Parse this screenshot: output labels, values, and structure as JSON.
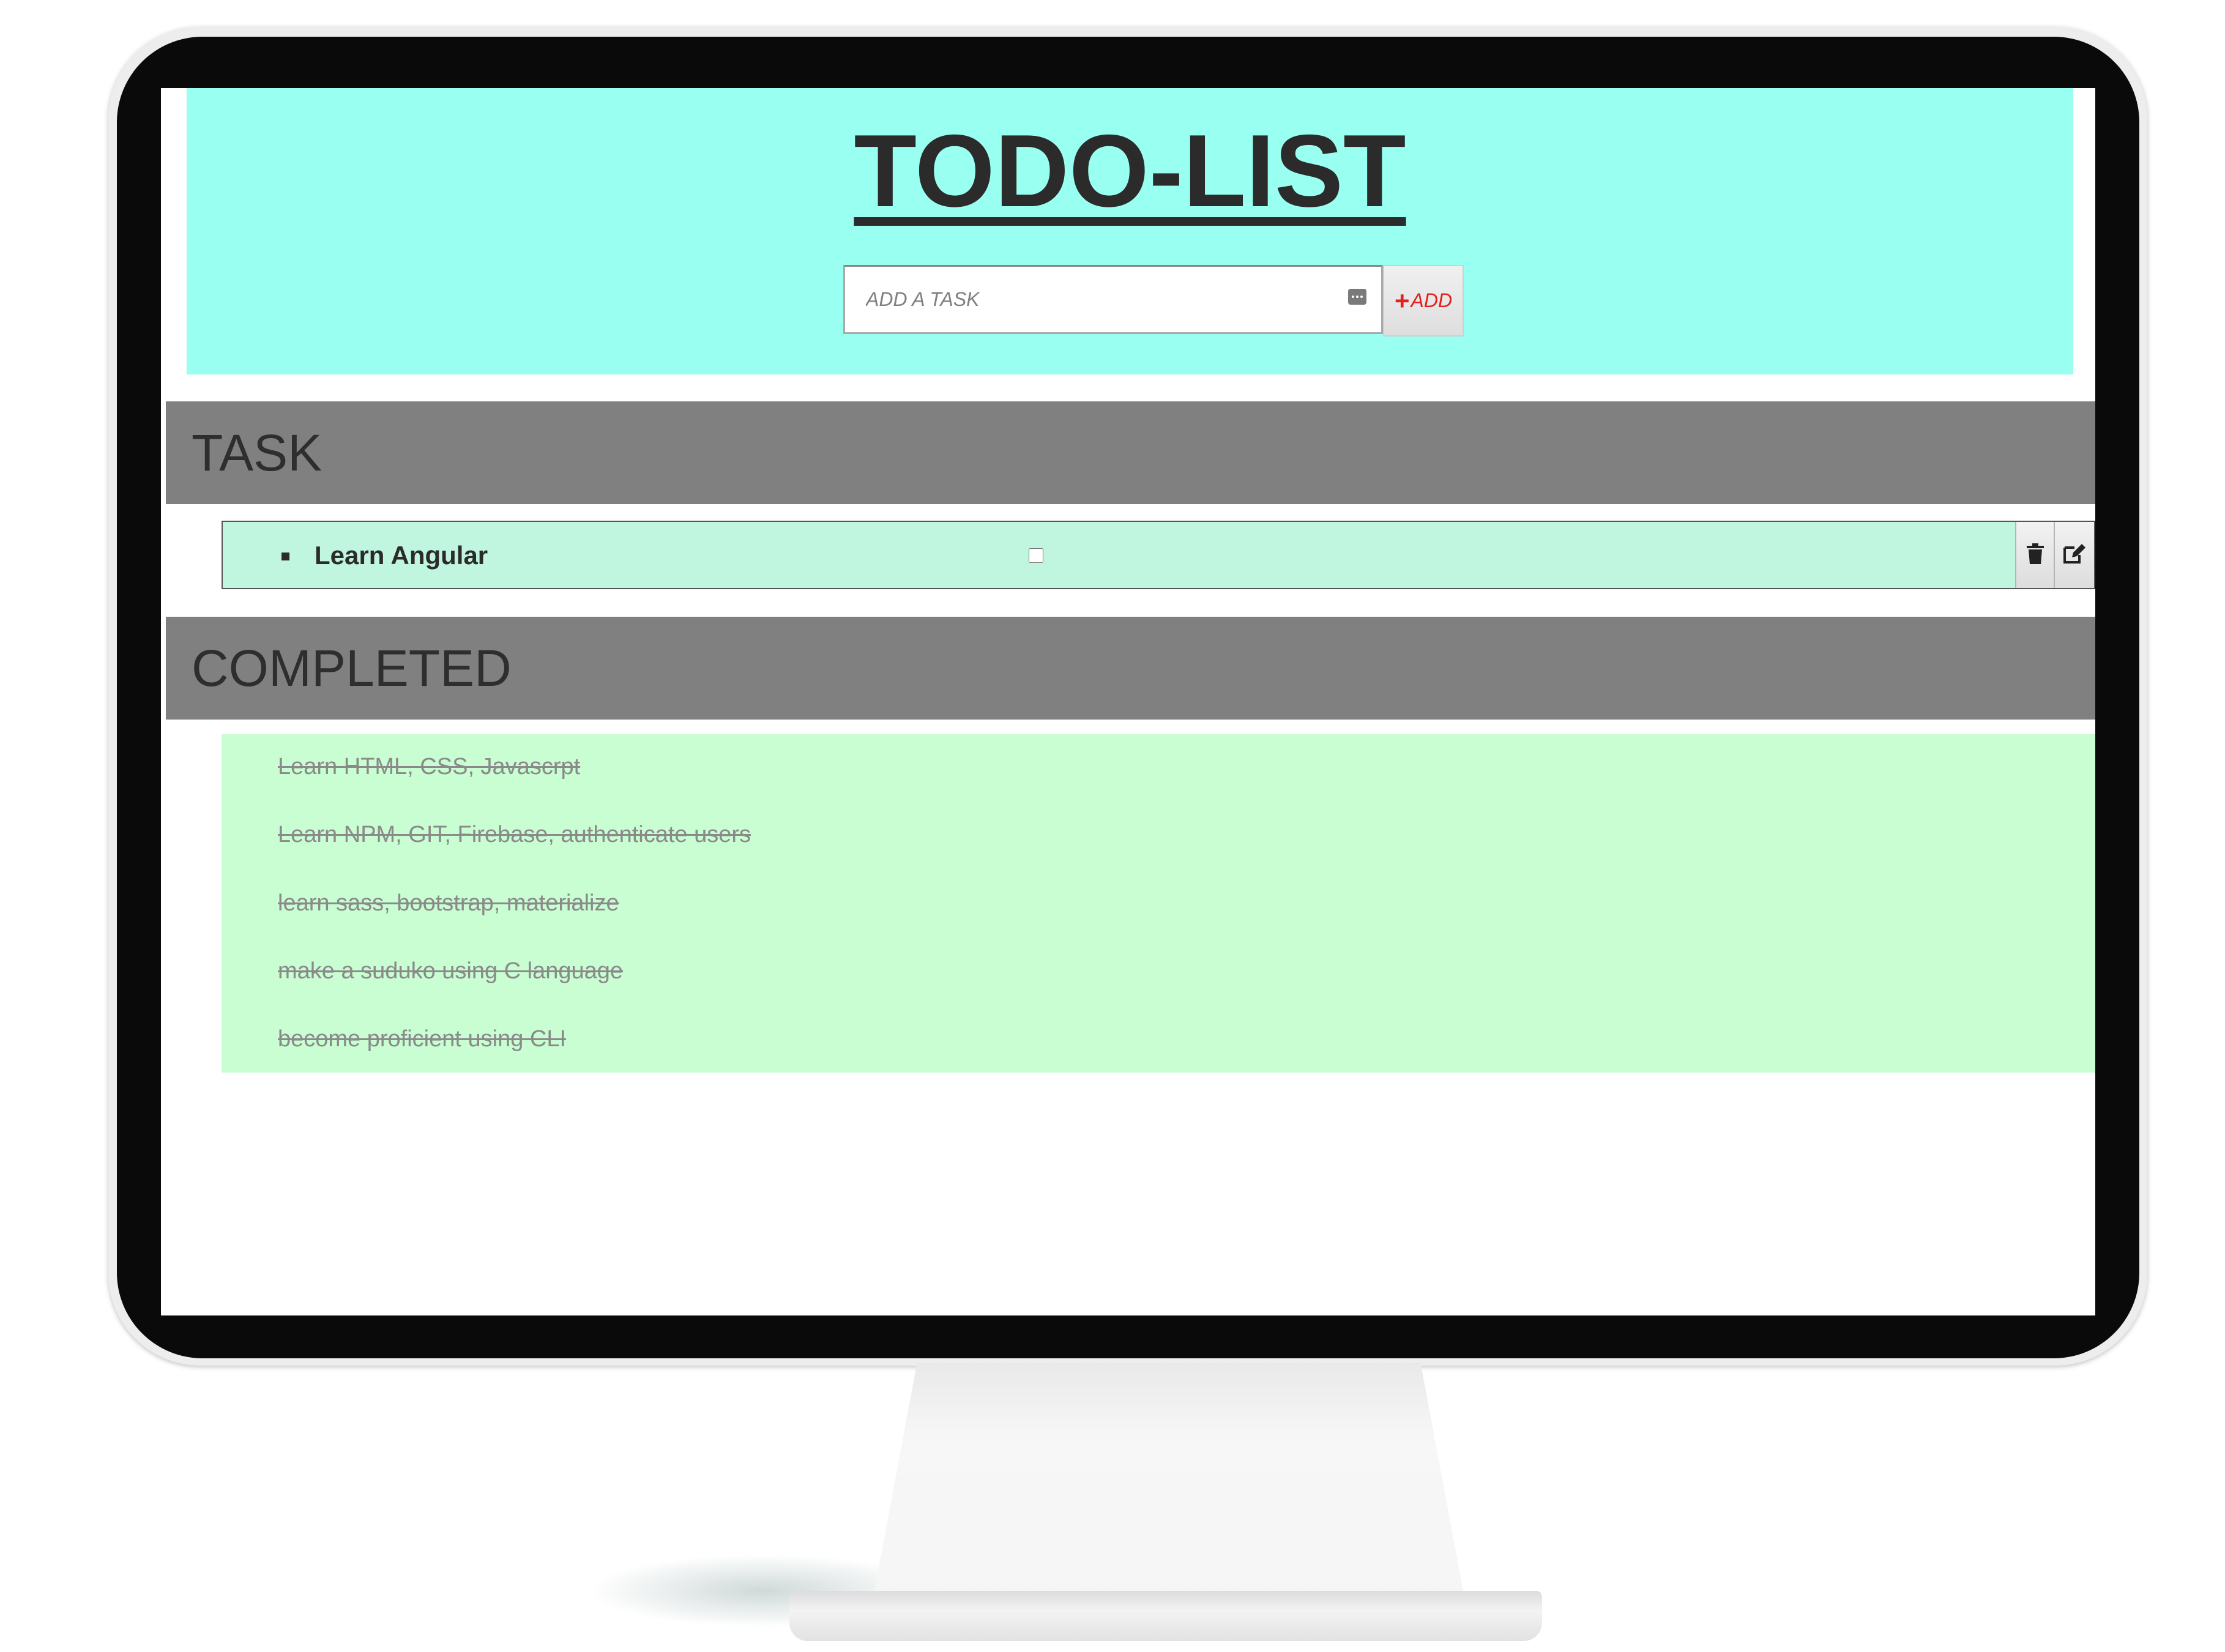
{
  "app": {
    "title": "TODO-LIST"
  },
  "add_form": {
    "placeholder": "ADD A TASK",
    "input_icon": "dots-icon",
    "button_plus": "+",
    "button_label": "ADD"
  },
  "sections": {
    "task_heading": "TASK",
    "completed_heading": "COMPLETED"
  },
  "tasks": [
    {
      "label": "Learn Angular",
      "checked": false,
      "actions": [
        "trash-icon",
        "edit-icon"
      ]
    }
  ],
  "completed": [
    "Learn HTML, CSS, Javascrpt",
    "Learn NPM, GIT, Firebase, authenticate users",
    "learn sass, bootstrap, materialize",
    "make a suduko using C language",
    "become proficient using CLI"
  ],
  "colors": {
    "header_bg": "#99fff0",
    "section_bar": "#808080",
    "task_row_bg": "#c0f5e0",
    "completed_bg": "#c8fed1",
    "add_accent": "#e0211c"
  }
}
